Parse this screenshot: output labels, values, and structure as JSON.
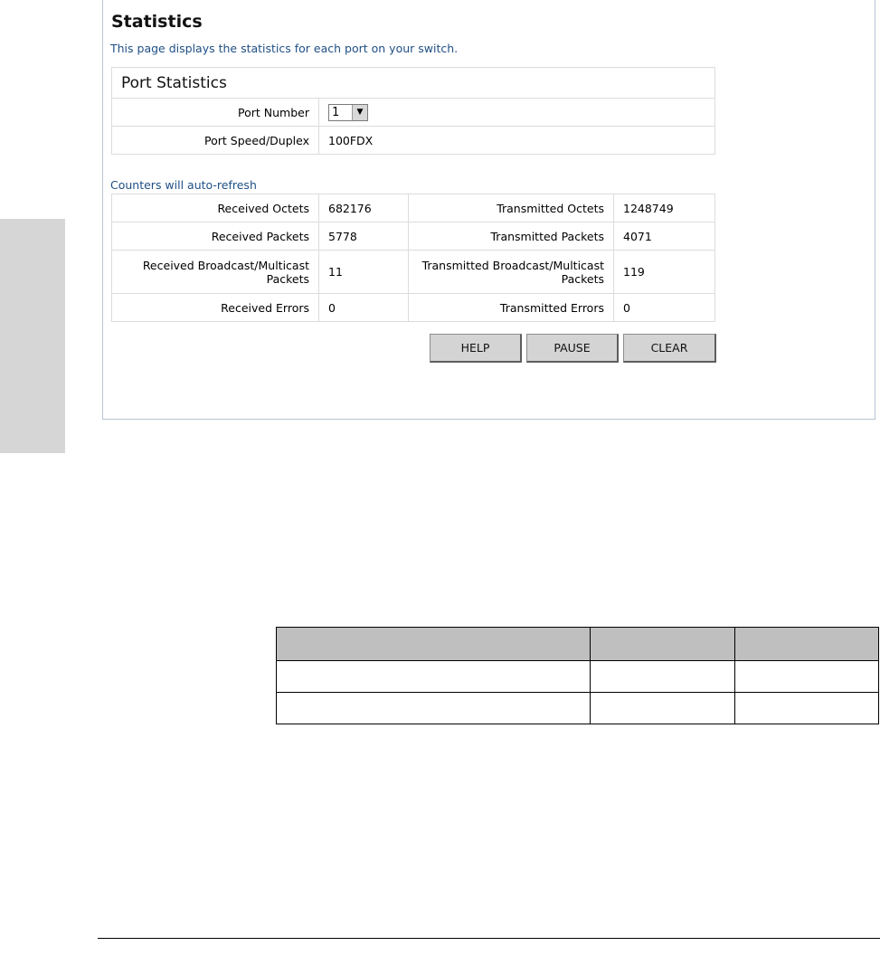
{
  "header": {
    "title": "Statistics",
    "description": "This page displays the statistics for each port on your switch."
  },
  "port_statistics": {
    "heading": "Port Statistics",
    "port_number_label": "Port Number",
    "port_number_value": "1",
    "port_speed_label": "Port Speed/Duplex",
    "port_speed_value": "100FDX"
  },
  "counters": {
    "note": "Counters will auto-refresh",
    "rows": [
      {
        "rx_label": "Received Octets",
        "rx_value": "682176",
        "tx_label": "Transmitted Octets",
        "tx_value": "1248749"
      },
      {
        "rx_label": "Received Packets",
        "rx_value": "5778",
        "tx_label": "Transmitted Packets",
        "tx_value": "4071"
      },
      {
        "rx_label": "Received Broadcast/Multicast Packets",
        "rx_value": "11",
        "tx_label": "Transmitted Broadcast/Multicast Packets",
        "tx_value": "119"
      },
      {
        "rx_label": "Received Errors",
        "rx_value": "0",
        "tx_label": "Transmitted Errors",
        "tx_value": "0"
      }
    ]
  },
  "buttons": {
    "help": "HELP",
    "pause": "PAUSE",
    "clear": "CLEAR"
  },
  "icons": {
    "dropdown": "chevron-down-icon"
  }
}
